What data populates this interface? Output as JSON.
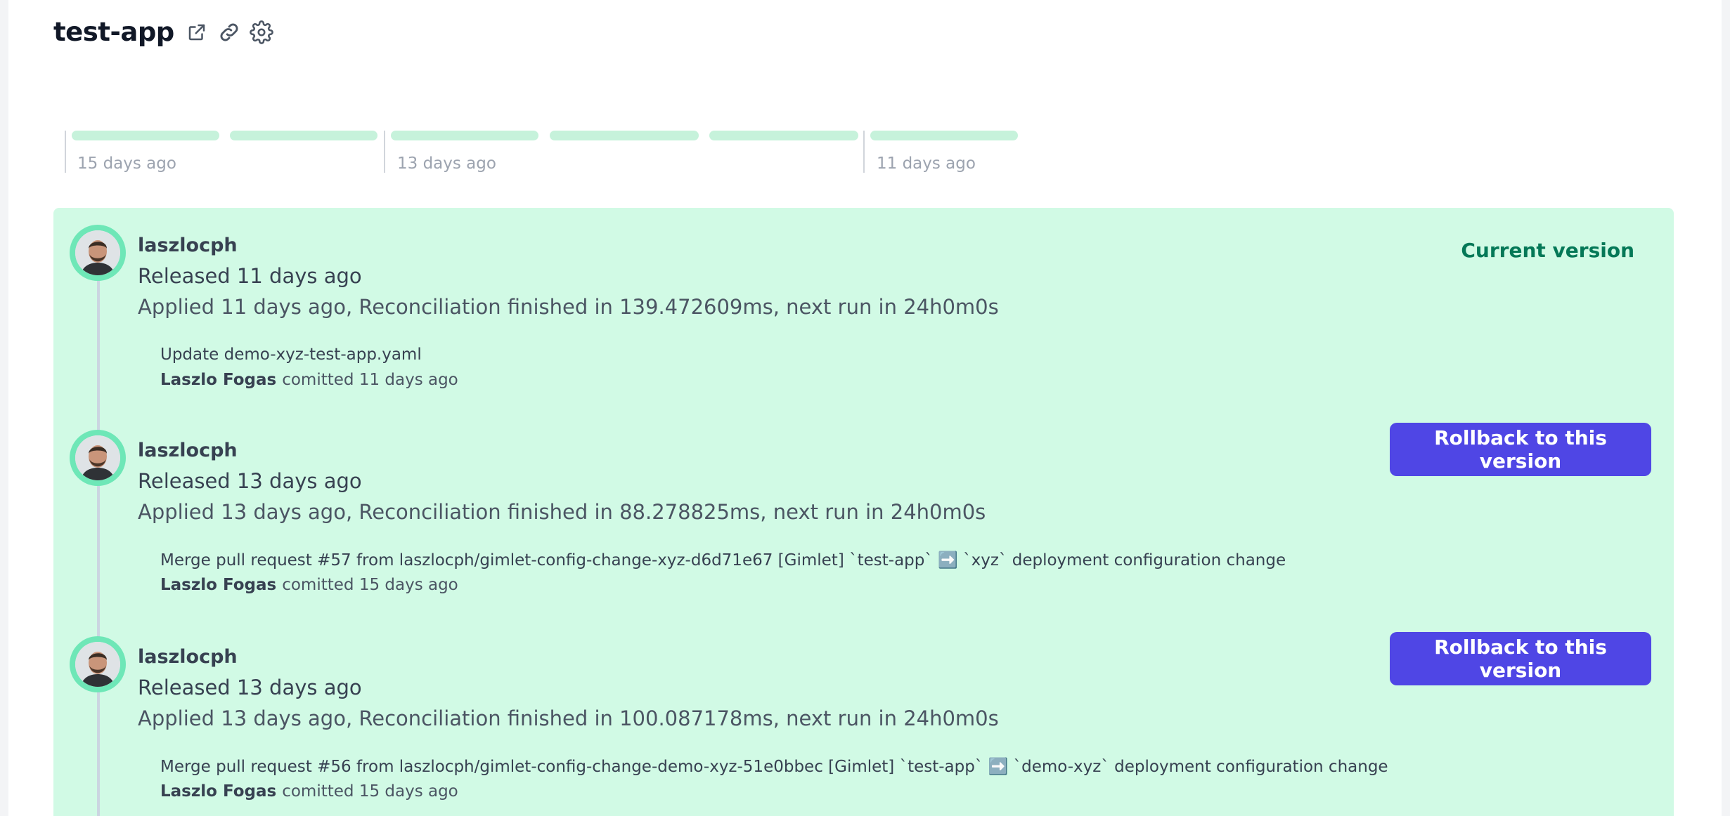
{
  "header": {
    "title": "test-app",
    "icons": [
      "external-link-icon",
      "link-icon",
      "gear-icon"
    ]
  },
  "timeline": {
    "labels": [
      "15 days ago",
      "13 days ago",
      "11 days ago"
    ],
    "bar_color": "#c6f2db"
  },
  "colors": {
    "panel_bg": "#d1fae5",
    "accent": "#4f46e5",
    "current_version": "#047857",
    "avatar_ring": "#6ee7b7"
  },
  "releases": [
    {
      "user": "laszlocph",
      "released": "Released 11 days ago",
      "applied": "Applied 11 days ago, Reconciliation finished in 139.472609ms, next run in 24h0m0s",
      "message": "Update demo-xyz-test-app.yaml",
      "author": "Laszlo Fogas",
      "committed": "comitted 11 days ago",
      "status": "Current version"
    },
    {
      "user": "laszlocph",
      "released": "Released 13 days ago",
      "applied": "Applied 13 days ago, Reconciliation finished in 88.278825ms, next run in 24h0m0s",
      "message": "Merge pull request #57 from laszlocph/gimlet-config-change-xyz-d6d71e67 [Gimlet] `test-app` ➡️ `xyz` deployment configuration change",
      "author": "Laszlo Fogas",
      "committed": "comitted 15 days ago",
      "action": "Rollback to this version"
    },
    {
      "user": "laszlocph",
      "released": "Released 13 days ago",
      "applied": "Applied 13 days ago, Reconciliation finished in 100.087178ms, next run in 24h0m0s",
      "message": "Merge pull request #56 from laszlocph/gimlet-config-change-demo-xyz-51e0bbec [Gimlet] `test-app` ➡️ `demo-xyz` deployment configuration change",
      "author": "Laszlo Fogas",
      "committed": "comitted 15 days ago",
      "action": "Rollback to this version"
    }
  ]
}
